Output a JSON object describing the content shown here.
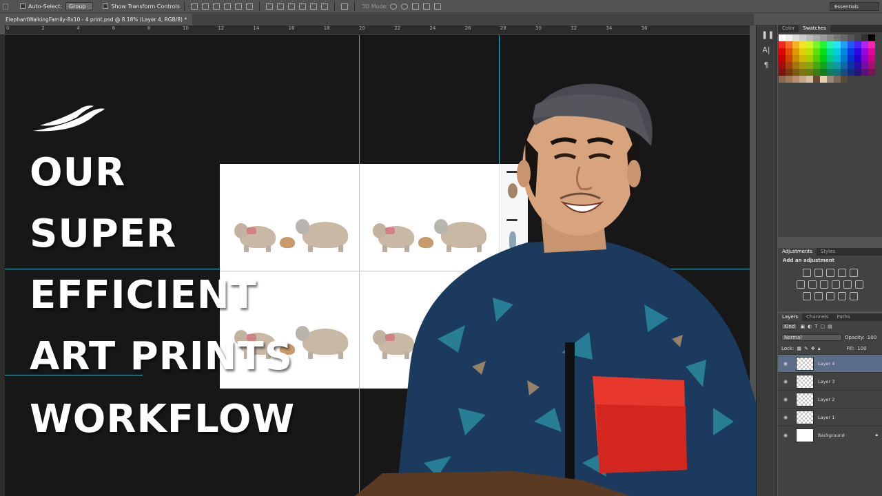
{
  "options_bar": {
    "auto_select_label": "Auto-Select:",
    "auto_select_value": "Group",
    "transform_label": "Show Transform Controls",
    "mode_3d_label": "3D Mode:",
    "workspace": "Essentials"
  },
  "document": {
    "tab_title": "ElephantWalkingFamily-8x10 - 4 print.psd @ 8.18% (Layer 4, RGB/8) *"
  },
  "ruler": {
    "ticks": [
      "0",
      "2",
      "4",
      "6",
      "8",
      "10",
      "12",
      "14",
      "16",
      "18",
      "20",
      "22",
      "24",
      "26",
      "28",
      "30",
      "32",
      "34",
      "36"
    ]
  },
  "title_lines": [
    "OUR",
    "SUPER",
    "EFFICIENT",
    "ART PRINTS",
    "WORKFLOW"
  ],
  "colors": {
    "teal": "#1f7a92",
    "maroon": "#7a1e2c",
    "guide": "#2ab6c8",
    "selected_layer": "#5b6d88"
  },
  "swatch_panel": {
    "tabs": [
      "Color",
      "Swatches"
    ]
  },
  "adjustments_panel": {
    "tabs": [
      "Adjustments",
      "Styles"
    ],
    "heading": "Add an adjustment"
  },
  "layers_panel": {
    "tabs": [
      "Layers",
      "Channels",
      "Paths"
    ],
    "filter_kind": "Kind",
    "blend_mode": "Normal",
    "opacity_label": "Opacity:",
    "opacity_value": "100",
    "lock_label": "Lock:",
    "fill_label": "Fill:",
    "fill_value": "100",
    "layers": [
      "Layer 4",
      "Layer 3",
      "Layer 2",
      "Layer 1",
      "Background"
    ]
  },
  "side_tools": {
    "icons": [
      "character-icon",
      "paragraph-icon"
    ]
  }
}
